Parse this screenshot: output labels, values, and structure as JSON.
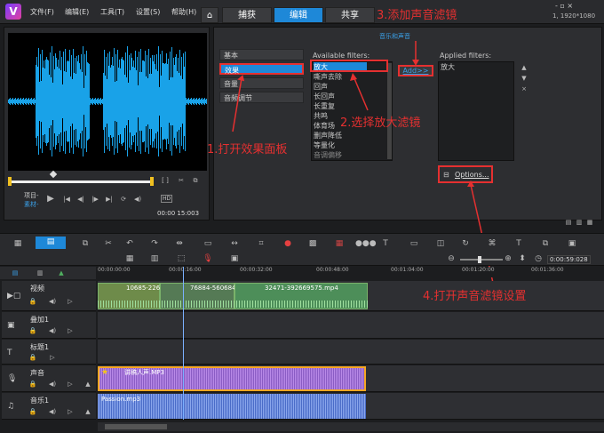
{
  "menu": {
    "file": "文件(F)",
    "edit": "编辑(E)",
    "tools": "工具(T)",
    "settings": "设置(S)",
    "help": "帮助(H)"
  },
  "tabs": {
    "capture": "捕获",
    "edit": "编辑",
    "share": "共享"
  },
  "resolution": "1, 1920*1080",
  "annotations": {
    "step1": "1.打开效果面板",
    "step2": "2.选择放大滤镜",
    "step3": "3.添加声音滤镜",
    "step4": "4.打开声音滤镜设置"
  },
  "preview": {
    "project_label": "项目-",
    "clip_label": "素材-",
    "timecode": "00:00 15:003"
  },
  "filter_panel": {
    "header": "音乐和声音",
    "categories": [
      "基本",
      "效果",
      "音量",
      "音频调节"
    ],
    "available_label": "Available filters:",
    "available_filters": [
      "放大",
      "嘶声去除",
      "回声",
      "长回声",
      "长重复",
      "共鸣",
      "体育场",
      "删声降低",
      "等量化",
      "音调偏移"
    ],
    "add_button": "Add>>",
    "applied_label": "Applied filters:",
    "applied_filters": [
      "放大"
    ],
    "options_button": "Options..."
  },
  "timeline": {
    "timecode": "0:00:59:028",
    "ruler": [
      "00:00:00:00",
      "00:00:16:00",
      "00:00:32:00",
      "00:00:48:00",
      "00:01:04:00",
      "00:01:20:00",
      "00:01:36:00"
    ],
    "tracks": [
      {
        "name": "视频"
      },
      {
        "name": "叠加1"
      },
      {
        "name": "标题1"
      },
      {
        "name": "声音"
      },
      {
        "name": "音乐1"
      }
    ],
    "video_clips": [
      "10685-226",
      "76884-5606843",
      "32471-392669575.mp4"
    ],
    "voice_clip": "讲稿人声.MP3",
    "music_clip": "Passion.mp3"
  }
}
